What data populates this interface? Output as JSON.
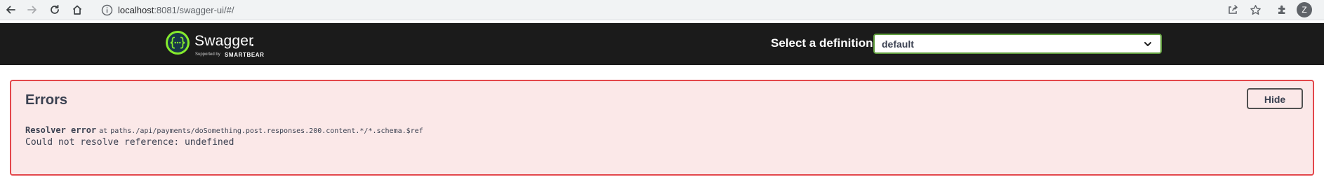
{
  "browser": {
    "url_host": "localhost",
    "url_rest": ":8081/swagger-ui/#/",
    "profile_initial": "Z"
  },
  "topbar": {
    "logo_text": "Swagger",
    "logo_supported_by": "Supported by",
    "logo_smartbear": "SMARTBEAR",
    "select_label": "Select a definition",
    "select_value": "default"
  },
  "errors": {
    "title": "Errors",
    "hide_label": "Hide",
    "items": [
      {
        "type": "Resolver error",
        "at_label": "at",
        "path": "paths./api/payments/doSomething.post.responses.200.content.*/*.schema.$ref",
        "message": "Could not resolve reference: undefined"
      }
    ]
  },
  "colors": {
    "topbar_bg": "#1b1b1b",
    "swagger_green": "#85ea2d",
    "select_border": "#62a03f",
    "error_bg": "#fbe8e8",
    "error_border": "#e3474b"
  }
}
